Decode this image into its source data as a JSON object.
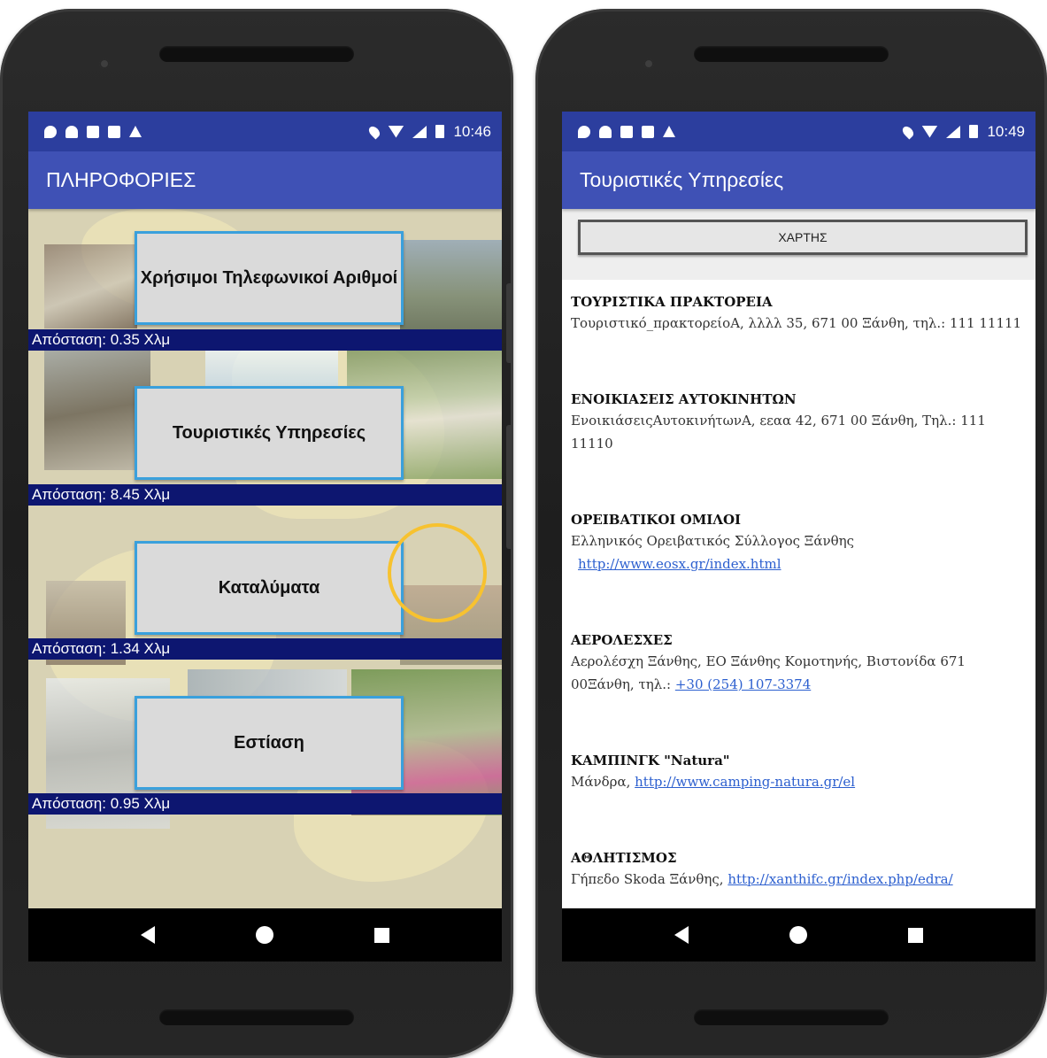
{
  "left_phone": {
    "status": {
      "time": "10:46"
    },
    "app_title": "ΠΛΗΡΟΦΟΡΙΕΣ",
    "menu": [
      {
        "label": "Χρήσιμοι Τηλεφωνικοί Αριθμοί",
        "distance": "Απόσταση: 0.35 Χλμ"
      },
      {
        "label": "Τουριστικές Υπηρεσίες",
        "distance": "Απόσταση: 8.45 Χλμ"
      },
      {
        "label": "Καταλύματα",
        "distance": "Απόσταση: 1.34 Χλμ"
      },
      {
        "label": "Εστίαση",
        "distance": "Απόσταση: 0.95 Χλμ"
      }
    ]
  },
  "right_phone": {
    "status": {
      "time": "10:49"
    },
    "app_title": "Τουριστικές Υπηρεσίες",
    "map_button": "ΧΑΡΤΗΣ",
    "items": [
      {
        "title": "ΤΟΥΡΙΣΤΙΚΑ ΠΡΑΚΤΟΡΕΙΑ",
        "text": "Τουριστικό_πρακτορείοΑ, λλλλ 35, 671 00 Ξάνθη, τηλ.: 111 11111"
      },
      {
        "title": "ΕΝΟΙΚΙΑΣΕΙΣ ΑΥΤΟΚΙΝΗΤΩΝ",
        "text": "ΕνοικιάσειςΑυτοκινήτωνΑ, εεαα 42, 671 00 Ξάνθη, Τηλ.: 111 11110"
      },
      {
        "title": "ΟΡΕΙΒΑΤΙΚΟΙ ΟΜΙΛΟΙ",
        "text": "Ελληνικός Ορειβατικός Σύλλογος Ξάνθης",
        "link": "http://www.eosx.gr/index.html"
      },
      {
        "title": "ΑΕΡΟΛΕΣΧΕΣ",
        "text": "Αερολέσχη Ξάνθης, ΕΟ Ξάνθης Κομοτηνής, Βιστονίδα 671 00Ξάνθη, τηλ.:",
        "link": "+30 (254) 107-3374"
      },
      {
        "title": "ΚΑΜΠΙΝΓΚ \"Natura\"",
        "text": "Μάνδρα,",
        "link": "http://www.camping-natura.gr/el"
      },
      {
        "title": "ΑΘΛΗΤΙΣΜΟΣ",
        "text": "Γήπεδο Skoda Ξάνθης,",
        "link": "http://xanthifc.gr/index.php/edra/"
      }
    ]
  },
  "colors": {
    "status_bar": "#2c3e9e",
    "app_bar": "#3f51b5",
    "distance_strip": "#0d1670",
    "button_border": "#3aa0dc",
    "highlight_ring": "#f7c22f",
    "link": "#2c5fcf"
  },
  "icons": {
    "status_left": [
      "shield-icon",
      "cloud-icon",
      "sd-card-icon",
      "image-icon",
      "play-store-icon"
    ],
    "status_right": [
      "location-icon",
      "wifi-icon",
      "signal-icon",
      "battery-icon"
    ],
    "nav": [
      "back-icon",
      "home-icon",
      "recents-icon"
    ]
  }
}
